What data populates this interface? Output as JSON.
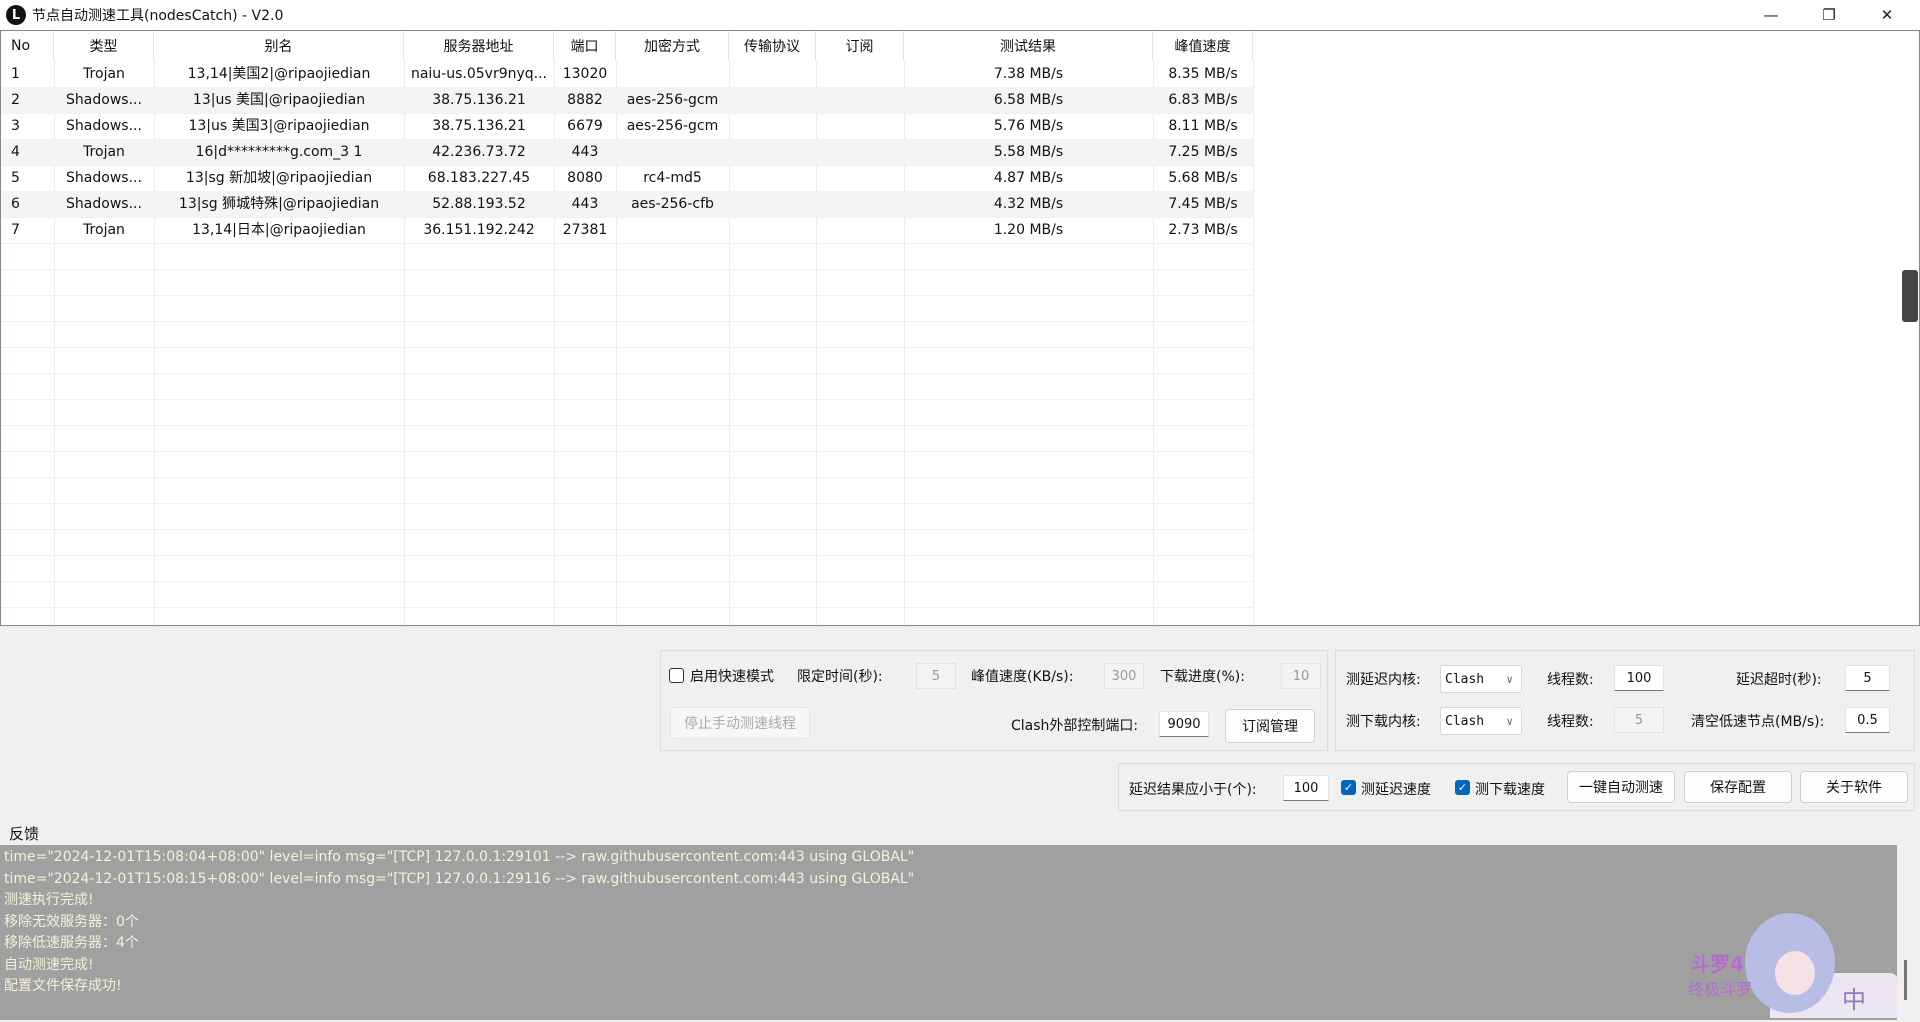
{
  "window": {
    "title": "节点自动测速工具(nodesCatch) - V2.0",
    "app_icon": "L",
    "minimize": "—",
    "restore": "❐",
    "close": "✕"
  },
  "table": {
    "columns": [
      "No",
      "类型",
      "别名",
      "服务器地址",
      "端口",
      "加密方式",
      "传输协议",
      "订阅",
      "测试结果",
      "峰值速度"
    ],
    "rows": [
      [
        "1",
        "Trojan",
        "13,14|美国2|@ripaojiedian",
        "naiu-us.05vr9nyq...",
        "13020",
        "",
        "",
        "",
        "7.38 MB/s",
        "8.35 MB/s"
      ],
      [
        "2",
        "Shadows...",
        "13|us 美国|@ripaojiedian",
        "38.75.136.21",
        "8882",
        "aes-256-gcm",
        "",
        "",
        "6.58 MB/s",
        "6.83 MB/s"
      ],
      [
        "3",
        "Shadows...",
        "13|us 美国3|@ripaojiedian",
        "38.75.136.21",
        "6679",
        "aes-256-gcm",
        "",
        "",
        "5.76 MB/s",
        "8.11 MB/s"
      ],
      [
        "4",
        "Trojan",
        "16|d*********g.com_3 1",
        "42.236.73.72",
        "443",
        "",
        "",
        "",
        "5.58 MB/s",
        "7.25 MB/s"
      ],
      [
        "5",
        "Shadows...",
        "13|sg 新加坡|@ripaojiedian",
        "68.183.227.45",
        "8080",
        "rc4-md5",
        "",
        "",
        "4.87 MB/s",
        "5.68 MB/s"
      ],
      [
        "6",
        "Shadows...",
        "13|sg 狮城特殊|@ripaojiedian",
        "52.88.193.52",
        "443",
        "aes-256-cfb",
        "",
        "",
        "4.32 MB/s",
        "7.45 MB/s"
      ],
      [
        "7",
        "Trojan",
        "13,14|日本|@ripaojiedian",
        "36.151.192.242",
        "27381",
        "",
        "",
        "",
        "1.20 MB/s",
        "2.73 MB/s"
      ]
    ]
  },
  "fast": {
    "enable_label": "启用快速模式",
    "enabled": false,
    "time_label": "限定时间(秒):",
    "time_value": "5",
    "peak_label": "峰值速度(KB/s):",
    "peak_value": "300",
    "progress_label": "下载进度(%):",
    "progress_value": "10",
    "stop_button": "停止手动测速线程",
    "port_label": "Clash外部控制端口:",
    "port_value": "9090",
    "sub_button": "订阅管理"
  },
  "core": {
    "latency_core_label": "测延迟内核:",
    "latency_core": "Clash",
    "threads_label": "线程数:",
    "latency_threads": "100",
    "timeout_label": "延迟超时(秒):",
    "timeout_value": "5",
    "download_core_label": "测下载内核:",
    "download_core": "Clash",
    "download_threads": "5",
    "clear_label": "清空低速节点(MB/s):",
    "clear_value": "0.5"
  },
  "actions": {
    "limit_label": "延迟结果应小于(个):",
    "limit_value": "100",
    "test_latency": "测延迟速度",
    "test_latency_checked": true,
    "test_download": "测下载速度",
    "test_download_checked": true,
    "auto_button": "一键自动测速",
    "save_button": "保存配置",
    "about_button": "关于软件"
  },
  "feedback": {
    "label": "反馈",
    "lines": [
      "time=\"2024-12-01T15:08:04+08:00\" level=info msg=\"[TCP] 127.0.0.1:29101 --> raw.githubusercontent.com:443 using GLOBAL\"",
      "time=\"2024-12-01T15:08:15+08:00\" level=info msg=\"[TCP] 127.0.0.1:29116 --> raw.githubusercontent.com:443 using GLOBAL\"",
      "测速执行完成!",
      "移除无效服务器：0个",
      "移除低速服务器：4个",
      "自动测速完成!",
      "配置文件保存成功!"
    ]
  },
  "ime": {
    "mode": "中",
    "logo": "斗罗大陆4 终极斗罗"
  },
  "colors": {
    "accent": "#0067c0",
    "log_bg": "#a0a0a0"
  }
}
